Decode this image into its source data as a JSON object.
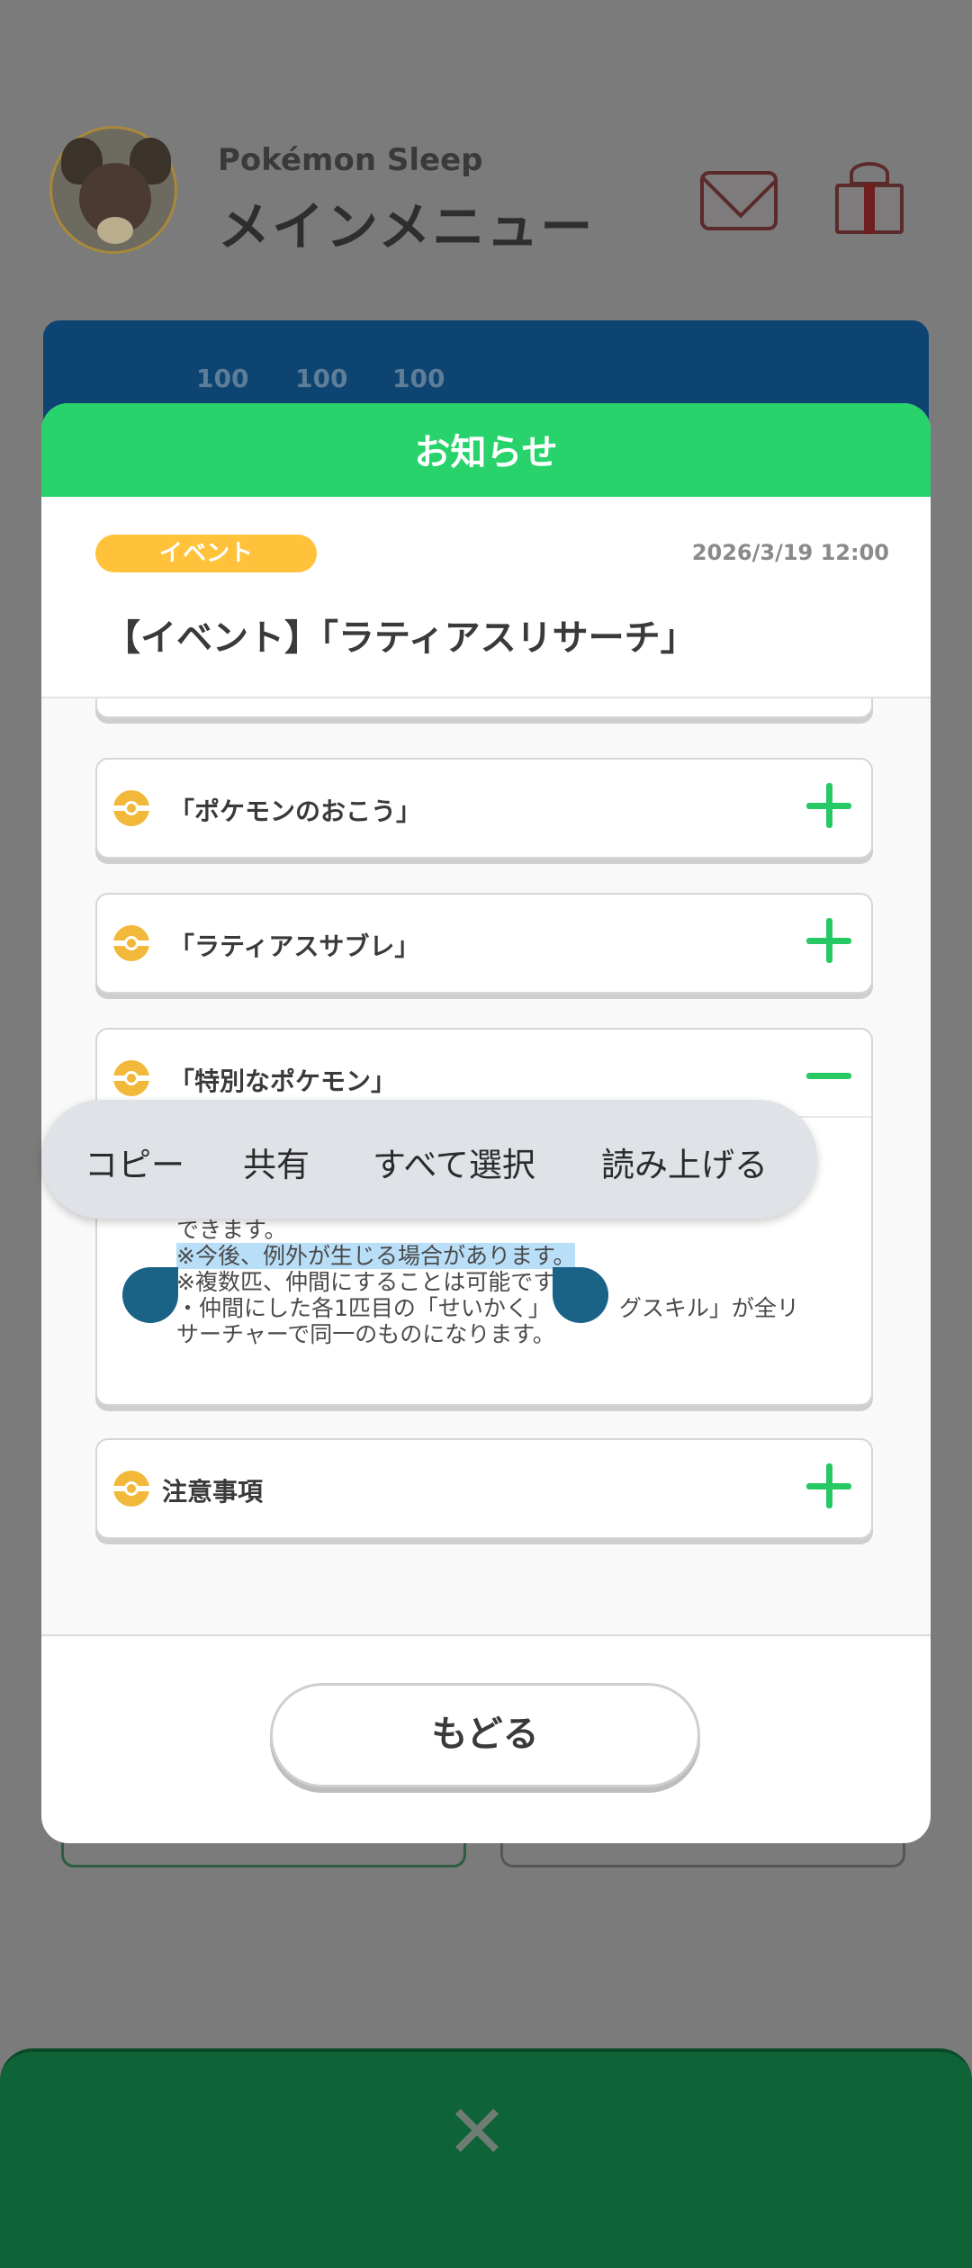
{
  "header": {
    "app_name": "Pokémon Sleep",
    "title": "メインメニュー",
    "icons": [
      "avatar",
      "mail-icon",
      "gift-icon"
    ]
  },
  "background": {
    "stats": [
      "100",
      "100",
      "100"
    ]
  },
  "modal": {
    "title": "お知らせ",
    "badge": "イベント",
    "date": "2026/3/19 12:00",
    "news_title": "【イベント】「ラティアスリサーチ」",
    "sections": [
      {
        "label": "「ポケモンのおこう」",
        "state": "collapsed"
      },
      {
        "label": "「ラティアスサブレ」",
        "state": "collapsed"
      },
      {
        "label": "「特別なポケモン」",
        "state": "expanded"
      },
      {
        "label": "注意事項",
        "state": "collapsed"
      }
    ],
    "expanded_text": {
      "line1": "できます。",
      "line2": "※今後、例外が生じる場合があります。",
      "line3": "※複数匹、仲間にすることは可能です",
      "line4a": "・仲間にした各1匹目の「せいかく」",
      "line4b": "グスキル」が全リ",
      "line5": "サーチャーで同一のものになります。"
    },
    "back_button": "もどる"
  },
  "selection_menu": {
    "items": [
      "コピー",
      "共有",
      "すべて選択",
      "読み上げる"
    ]
  },
  "bottom_bar": {
    "close_symbol": "✕"
  },
  "colors": {
    "accent_green": "#27d36a",
    "badge_yellow": "#ffc23a",
    "header_blue": "#0e4471",
    "close_bar_green": "#0e6337",
    "selection_highlight": "#b9def7"
  }
}
